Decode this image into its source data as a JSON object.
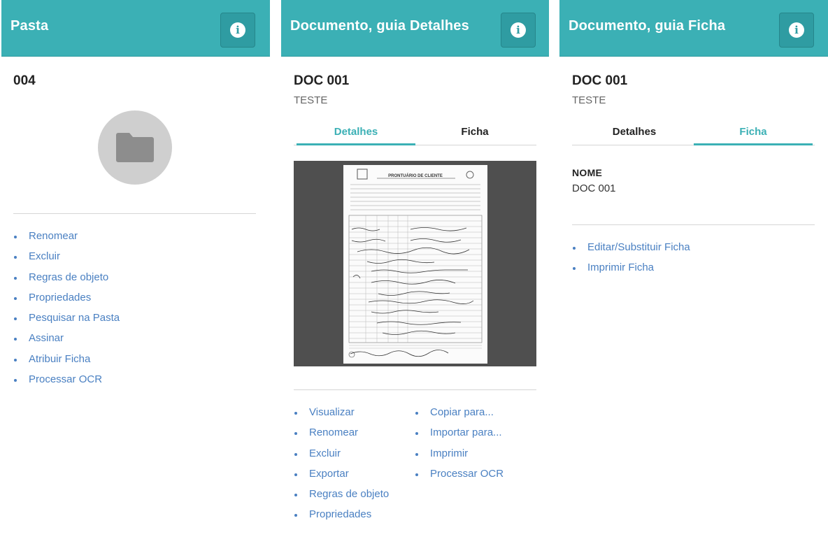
{
  "colors": {
    "header": "#3bb0b5",
    "accent": "#3bb0b5",
    "link": "#4a80c2"
  },
  "pasta": {
    "header_title": "Pasta",
    "info_icon": "info-icon",
    "name": "004",
    "folder_icon": "folder-icon",
    "actions": [
      "Renomear",
      "Excluir",
      "Regras de objeto",
      "Propriedades",
      "Pesquisar na Pasta",
      "Assinar",
      "Atribuir Ficha",
      "Processar OCR"
    ]
  },
  "detalhes": {
    "header_title": "Documento, guia Detalhes",
    "info_icon": "info-icon",
    "name": "DOC 001",
    "subtitle": "TESTE",
    "tabs": [
      "Detalhes",
      "Ficha"
    ],
    "active_tab": "Detalhes",
    "preview": {
      "form_title": "PRONTUÁRIO DE CLIENTE"
    },
    "actions_col1": [
      "Visualizar",
      "Renomear",
      "Excluir",
      "Exportar",
      "Regras de objeto",
      "Propriedades"
    ],
    "actions_col2": [
      "Copiar para...",
      "Importar para...",
      "Imprimir",
      "Processar OCR"
    ]
  },
  "ficha": {
    "header_title": "Documento, guia Ficha",
    "info_icon": "info-icon",
    "name": "DOC 001",
    "subtitle": "TESTE",
    "tabs": [
      "Detalhes",
      "Ficha"
    ],
    "active_tab": "Ficha",
    "field_label": "NOME",
    "field_value": "DOC 001",
    "actions": [
      "Editar/Substituir Ficha",
      "Imprimir Ficha"
    ]
  }
}
